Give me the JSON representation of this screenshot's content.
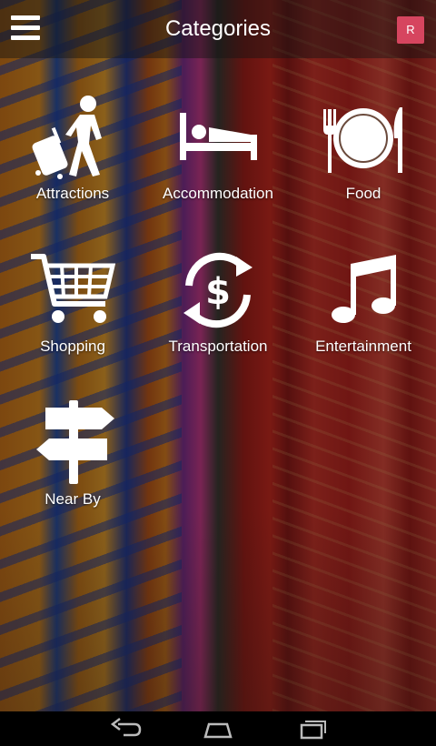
{
  "header": {
    "title": "Categories",
    "avatar_letter": "R"
  },
  "categories": [
    {
      "label": "Attractions",
      "icon": "traveler-with-luggage-icon"
    },
    {
      "label": "Accommodation",
      "icon": "bed-icon"
    },
    {
      "label": "Food",
      "icon": "plate-fork-knife-icon"
    },
    {
      "label": "Shopping",
      "icon": "shopping-cart-icon"
    },
    {
      "label": "Transportation",
      "icon": "currency-exchange-icon"
    },
    {
      "label": "Entertainment",
      "icon": "music-note-icon"
    },
    {
      "label": "Near By",
      "icon": "signpost-icon"
    }
  ],
  "system_nav": [
    "back-icon",
    "home-icon",
    "recent-apps-icon"
  ],
  "colors": {
    "avatar": "#d6455f",
    "appbar": "rgba(20,20,20,0.45)",
    "navbar": "#000000"
  }
}
